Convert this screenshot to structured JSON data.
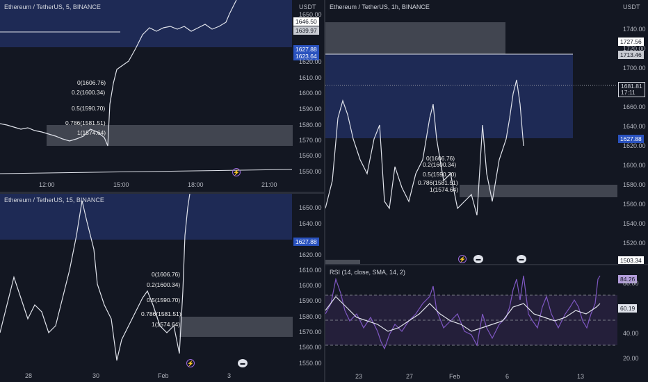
{
  "panes": {
    "top_left": {
      "title": "Ethereum / TetherUS, 5, BINANCE",
      "currency": "USDT",
      "y_labels": [
        "1650.00",
        "1620.00",
        "1610.00",
        "1600.00",
        "1590.00",
        "1580.00",
        "1570.00",
        "1560.00",
        "1550.00"
      ],
      "x_labels": [
        "12:00",
        "15:00",
        "18:00",
        "21:00"
      ],
      "price_tags": {
        "last": "1646.50",
        "line": "1639.97",
        "zone": "1627.88",
        "zone2": "1623.64"
      },
      "fib": [
        "0(1606.76)",
        "0.2(1600.34)",
        "0.5(1590.70)",
        "0.786(1581.51)",
        "1(1574.64)"
      ]
    },
    "bottom_left": {
      "title": "Ethereum / TetherUS, 15, BINANCE",
      "y_labels": [
        "1650.00",
        "1640.00",
        "1620.00",
        "1610.00",
        "1600.00",
        "1590.00",
        "1580.00",
        "1570.00",
        "1560.00",
        "1550.00"
      ],
      "x_labels": [
        "28",
        "30",
        "Feb",
        "3"
      ],
      "price_tags": {
        "zone": "1627.88"
      },
      "fib": [
        "0(1606.76)",
        "0.2(1600.34)",
        "0.5(1590.70)",
        "0.786(1581.51)",
        "1(1574.64)"
      ]
    },
    "right": {
      "title": "Ethereum / TetherUS, 1h, BINANCE",
      "currency": "USDT",
      "y_labels": [
        "1740.00",
        "1720.00",
        "1700.00",
        "1660.00",
        "1640.00",
        "1620.00",
        "1600.00",
        "1580.00",
        "1560.00",
        "1540.00",
        "1520.00"
      ],
      "x_labels": [
        "23",
        "27",
        "Feb",
        "6",
        "13"
      ],
      "price_tags": {
        "top": "1727.56",
        "top2": "1713.46",
        "last": "1681.81",
        "timer": "17:11",
        "zone": "1627.88",
        "low": "1503.34"
      },
      "fib": [
        "0(1606.76)",
        "0.2(1600.34)",
        "0.5(1590.70)",
        "0.786(1581.51)",
        "1(1574.64)"
      ]
    },
    "rsi": {
      "title": "RSI (14, close, SMA, 14, 2)",
      "y_labels": [
        "80.00",
        "40.00",
        "20.00"
      ],
      "value": "84.26",
      "sma": "60.19"
    }
  },
  "icons": {
    "flash": "lightning-icon",
    "flag": "flag-icon"
  },
  "colors": {
    "zone": "#1e2a55",
    "zone_label": "#2a52be",
    "grey_zone": "#4a4e58",
    "rsi_line": "#7e57c2",
    "rsi_bg": "#241f3a"
  }
}
